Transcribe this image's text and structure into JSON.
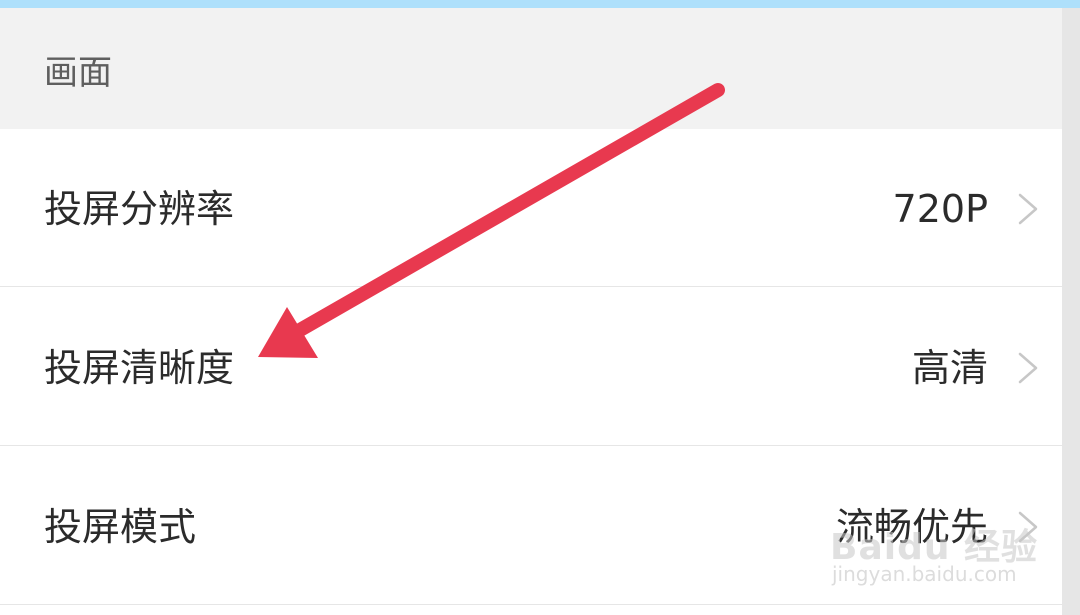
{
  "section": {
    "title": "画面"
  },
  "settings": [
    {
      "label": "投屏分辨率",
      "value": "720P"
    },
    {
      "label": "投屏清晰度",
      "value": "高清"
    },
    {
      "label": "投屏模式",
      "value": "流畅优先"
    }
  ],
  "annotation": {
    "arrow_color": "#e8394f"
  },
  "watermark": {
    "logo": "Baidu 经验",
    "url": "jingyan.baidu.com"
  },
  "icons": {
    "chevron": "chevron-right-icon"
  },
  "colors": {
    "header_bg": "#f2f2f2",
    "top_strip": "#aee0fb",
    "text": "#2b2b2b",
    "chevron": "#c7c7c7"
  }
}
